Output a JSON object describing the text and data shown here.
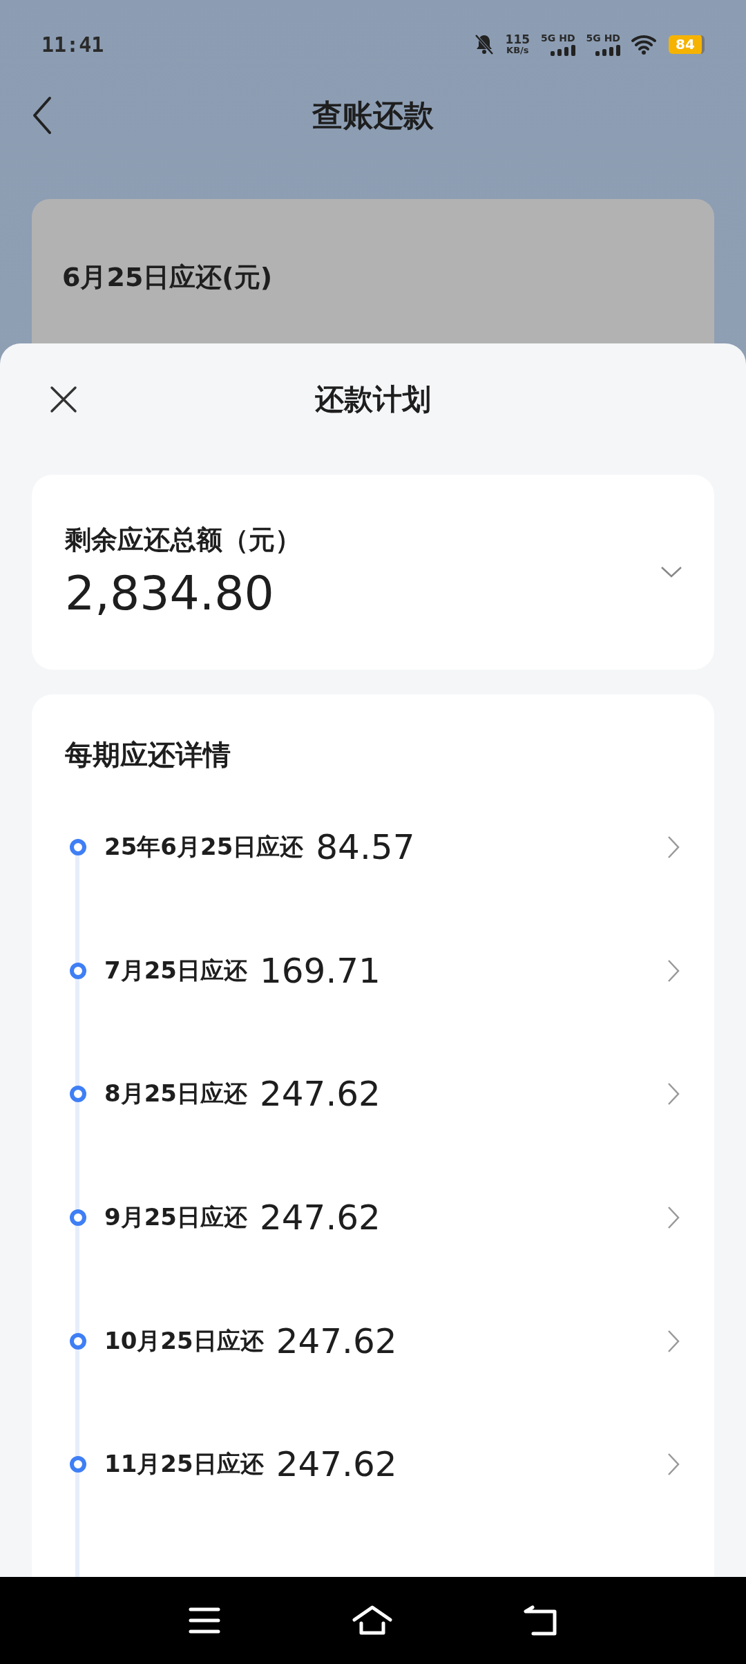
{
  "status_bar": {
    "time": "11:41",
    "net_speed": "115",
    "net_speed_unit": "KB/s",
    "sim_1": "5G HD",
    "sim_2": "5G HD",
    "battery": "84"
  },
  "page": {
    "title": "查账还款",
    "due_label": "6月25日应还(元)"
  },
  "sheet": {
    "title": "还款计划",
    "total": {
      "label": "剩余应还总额（元）",
      "amount": "2,834.80",
      "expanded": false
    },
    "schedule": {
      "title": "每期应还详情",
      "rows": [
        {
          "date": "25年6月25日应还",
          "amount": "84.57"
        },
        {
          "date": "7月25日应还",
          "amount": "169.71"
        },
        {
          "date": "8月25日应还",
          "amount": "247.62"
        },
        {
          "date": "9月25日应还",
          "amount": "247.62"
        },
        {
          "date": "10月25日应还",
          "amount": "247.62"
        },
        {
          "date": "11月25日应还",
          "amount": "247.62"
        }
      ]
    }
  }
}
